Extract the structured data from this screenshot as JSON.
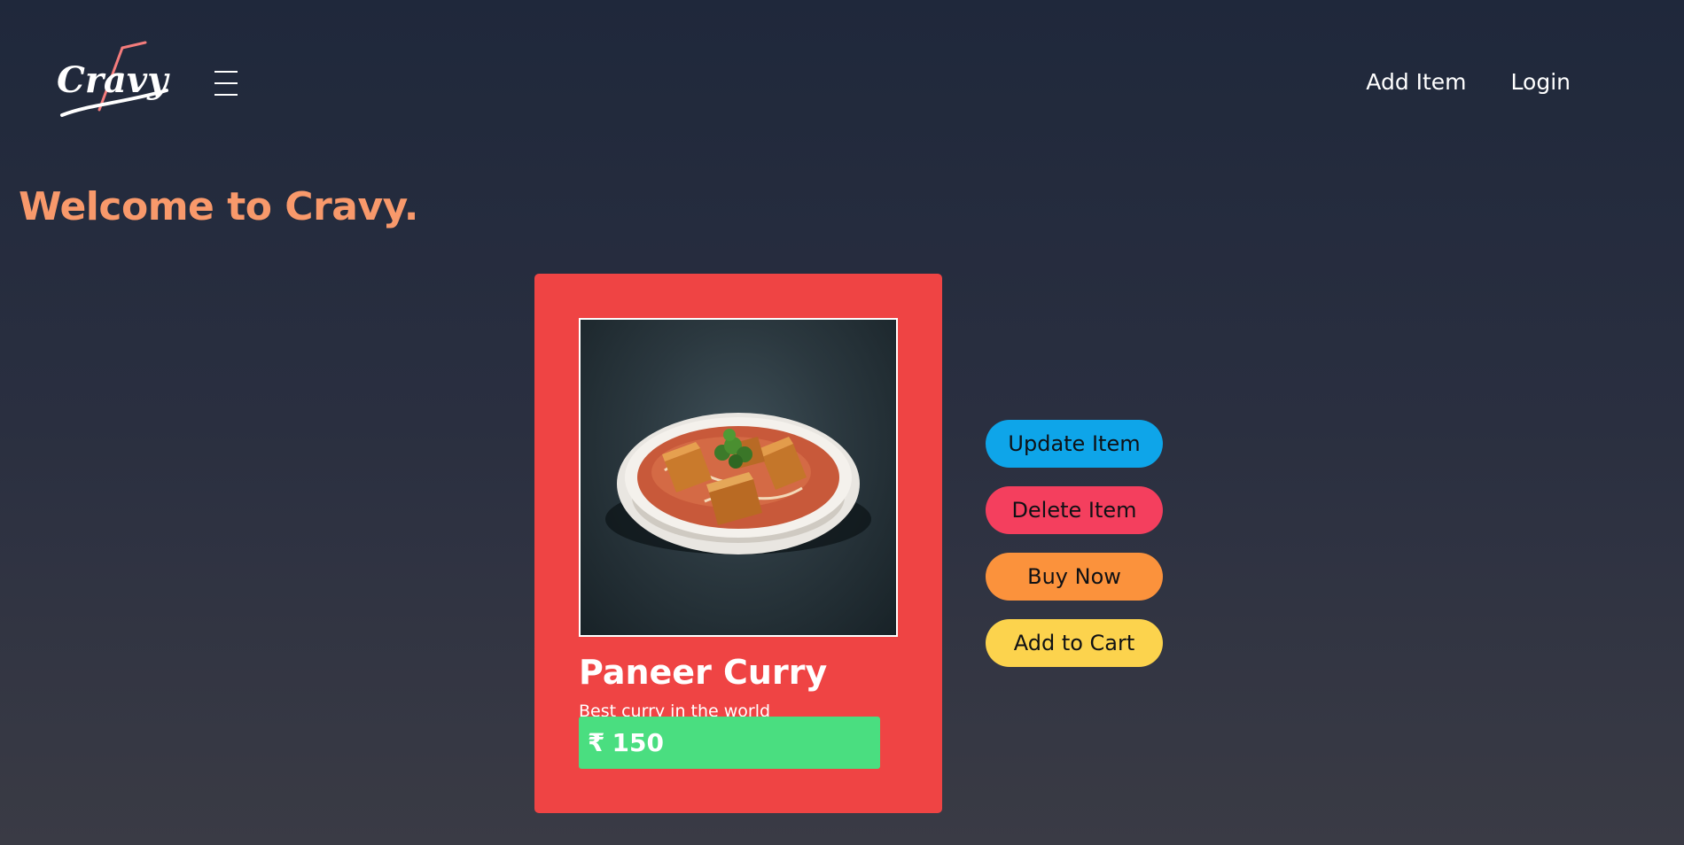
{
  "brand": {
    "name": "Cravy"
  },
  "nav": {
    "menu_icon": "hamburger-menu-icon",
    "links": [
      {
        "label": "Add Item"
      },
      {
        "label": "Login"
      }
    ]
  },
  "welcome": {
    "heading": "Welcome to Cravy."
  },
  "item": {
    "name": "Paneer Curry",
    "description": "Best curry in the world",
    "currency_symbol": "₹",
    "price": "150"
  },
  "actions": {
    "update_label": "Update Item",
    "delete_label": "Delete Item",
    "buy_label": "Buy Now",
    "cart_label": "Add to Cart"
  },
  "colors": {
    "accent_heading": "#f8996b",
    "card_background": "#ef4444",
    "price_background": "#4ade80",
    "update_button": "#0ea5e9",
    "delete_button": "#f43f5e",
    "buy_button": "#fb923c",
    "cart_button": "#fcd34d"
  }
}
